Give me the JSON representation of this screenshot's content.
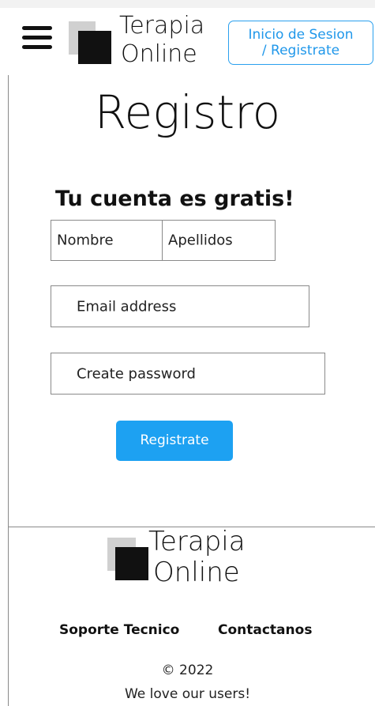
{
  "header": {
    "brand_line1": "Terapia",
    "brand_line2": "Online",
    "login_line1": "Inicio de  Sesion",
    "login_line2": "/ Registrate"
  },
  "main": {
    "title": "Registro",
    "subtitle": "Tu cuenta es gratis!",
    "fields": {
      "first_name_placeholder": "Nombre",
      "last_name_placeholder": "Apellidos",
      "email_placeholder": "Email address",
      "password_placeholder": "Create password"
    },
    "submit_label": "Registrate"
  },
  "footer": {
    "brand_line1": "Terapia",
    "brand_line2": "Online",
    "links": [
      "Soporte Tecnico",
      "Contactanos"
    ],
    "copyright": "© 2022",
    "tagline": "We love our users!"
  },
  "icons": {
    "menu": "hamburger-menu-icon",
    "logo": "logo-square-icon"
  },
  "colors": {
    "accent": "#1da1f2",
    "text": "#111111",
    "border": "#8a8a8a"
  }
}
